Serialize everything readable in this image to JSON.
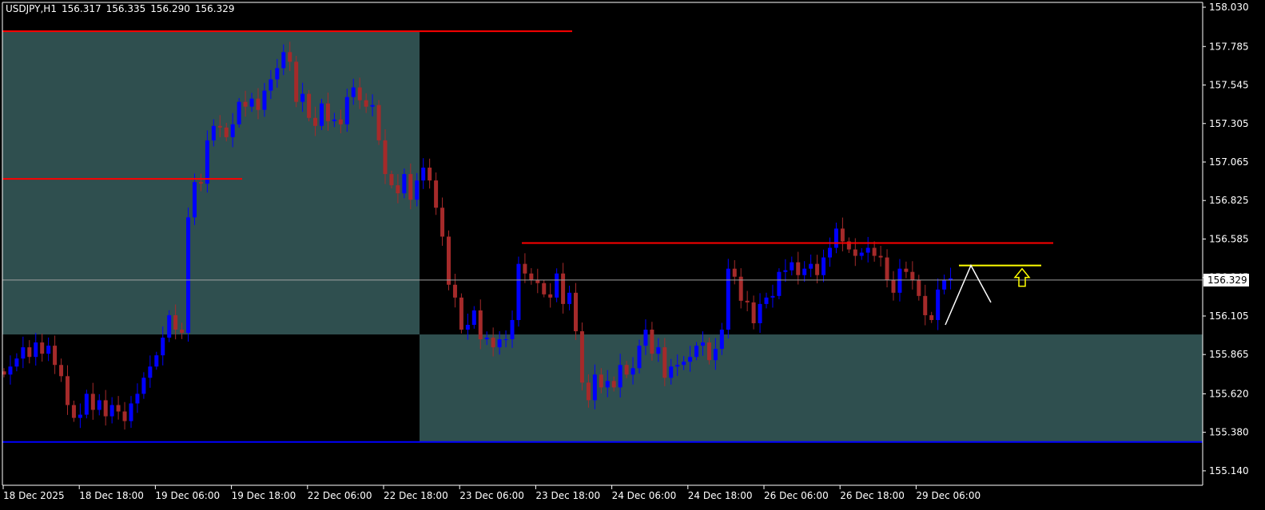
{
  "header": {
    "symbol": "USDJPY,H1",
    "open": "156.317",
    "high": "156.335",
    "low": "156.290",
    "close": "156.329"
  },
  "colors": {
    "background": "#000000",
    "bull_candle": "#0000ff",
    "bear_candle": "#a52a2a",
    "zone_fill": "#2f4f4f",
    "resistance_line": "#ff0000",
    "support_line": "#0000ff",
    "signal_line": "#ffff00",
    "projection": "#ffffff",
    "axis": "#ffffff"
  },
  "chart_data": {
    "type": "candlestick",
    "title": "",
    "symbol": "USDJPY",
    "timeframe": "H1",
    "ylim": [
      155.05,
      158.06
    ],
    "y_ticks": [
      "158.030",
      "157.785",
      "157.545",
      "157.305",
      "157.065",
      "156.825",
      "156.585",
      "156.345",
      "156.105",
      "155.865",
      "155.620",
      "155.380",
      "155.140"
    ],
    "x_ticks": [
      "18 Dec 2025",
      "18 Dec 18:00",
      "19 Dec 06:00",
      "19 Dec 18:00",
      "22 Dec 06:00",
      "22 Dec 18:00",
      "23 Dec 06:00",
      "23 Dec 18:00",
      "24 Dec 06:00",
      "24 Dec 18:00",
      "26 Dec 06:00",
      "26 Dec 18:00",
      "29 Dec 06:00"
    ],
    "current_price": "156.329",
    "horizontal_lines": [
      {
        "price": 157.88,
        "color": "red"
      },
      {
        "price": 156.96,
        "color": "red"
      },
      {
        "price": 156.56,
        "color": "red"
      },
      {
        "price": 155.32,
        "color": "blue"
      },
      {
        "price": 156.42,
        "color": "yellow"
      }
    ],
    "zones": [
      {
        "from": "18 Dec 2025",
        "to": "22 Dec 18:00",
        "y_low": 155.99,
        "y_high": 157.88
      },
      {
        "from": "22 Dec 18:00",
        "to": "29 Dec 06:00",
        "y_low": 155.32,
        "y_high": 155.99
      }
    ],
    "annotations": [
      {
        "type": "projection-path",
        "points": [
          156.05,
          156.42,
          156.19
        ]
      },
      {
        "type": "up-arrow",
        "color": "yellow"
      }
    ],
    "closes": [
      155.74,
      155.79,
      155.84,
      155.91,
      155.85,
      155.94,
      155.87,
      155.92,
      155.8,
      155.73,
      155.55,
      155.47,
      155.49,
      155.62,
      155.52,
      155.58,
      155.48,
      155.55,
      155.51,
      155.45,
      155.56,
      155.62,
      155.72,
      155.79,
      155.86,
      155.97,
      156.11,
      156.02,
      156.0,
      156.72,
      156.94,
      156.93,
      157.2,
      157.29,
      157.28,
      157.22,
      157.3,
      157.44,
      157.41,
      157.46,
      157.39,
      157.51,
      157.58,
      157.65,
      157.75,
      157.69,
      157.44,
      157.49,
      157.34,
      157.29,
      157.43,
      157.32,
      157.33,
      157.3,
      157.47,
      157.53,
      157.45,
      157.41,
      157.42,
      157.2,
      156.99,
      156.92,
      156.87,
      156.99,
      156.83,
      156.95,
      157.03,
      156.95,
      156.78,
      156.6,
      156.3,
      156.22,
      156.02,
      156.05,
      156.14,
      155.96,
      155.97,
      155.91,
      155.96,
      155.96,
      156.08,
      156.43,
      156.37,
      156.33,
      156.31,
      156.24,
      156.22,
      156.37,
      156.18,
      156.25,
      156.01,
      155.69,
      155.58,
      155.74,
      155.66,
      155.7,
      155.66,
      155.8,
      155.74,
      155.78,
      155.92,
      156.02,
      155.87,
      155.91,
      155.72,
      155.79,
      155.8,
      155.82,
      155.85,
      155.92,
      155.94,
      155.83,
      155.9,
      156.02,
      156.4,
      156.35,
      156.2,
      156.19,
      156.06,
      156.18,
      156.22,
      156.23,
      156.38,
      156.39,
      156.44,
      156.36,
      156.4,
      156.43,
      156.36,
      156.47,
      156.53,
      156.65,
      156.57,
      156.52,
      156.48,
      156.5,
      156.53,
      156.48,
      156.47,
      156.33,
      156.25,
      156.4,
      156.38,
      156.33,
      156.23,
      156.11,
      156.08,
      156.27,
      156.33,
      156.34
    ]
  }
}
